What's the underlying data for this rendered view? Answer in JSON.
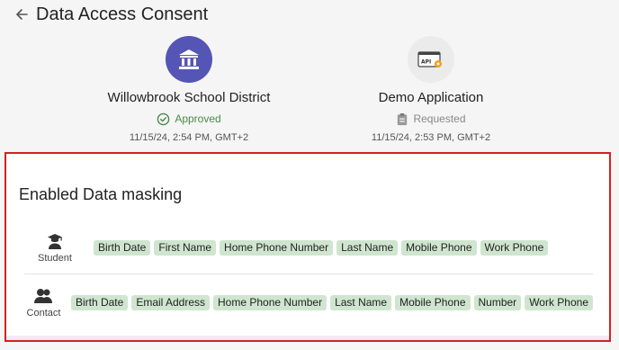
{
  "header": {
    "title": "Data Access Consent"
  },
  "parties": {
    "school": {
      "name": "Willowbrook School District",
      "status": "Approved",
      "timestamp": "11/15/24, 2:54 PM, GMT+2"
    },
    "app": {
      "name": "Demo Application",
      "status": "Requested",
      "timestamp": "11/15/24, 2:53 PM, GMT+2"
    }
  },
  "masking": {
    "title": "Enabled Data masking",
    "rows": [
      {
        "role": "Student",
        "icon": "student-icon",
        "fields": [
          "Birth Date",
          "First Name",
          "Home Phone Number",
          "Last Name",
          "Mobile Phone",
          "Work Phone"
        ]
      },
      {
        "role": "Contact",
        "icon": "contacts-icon",
        "fields": [
          "Birth Date",
          "Email Address",
          "Home Phone Number",
          "Last Name",
          "Mobile Phone",
          "Number",
          "Work Phone"
        ]
      }
    ]
  },
  "colors": {
    "accent": "#5555b5",
    "approved": "#4a8a4a",
    "chip": "#cfe5cf",
    "highlight_border": "#d42020"
  }
}
